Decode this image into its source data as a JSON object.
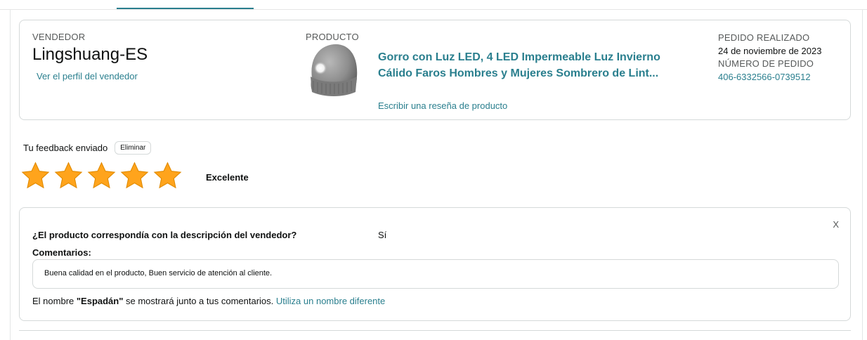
{
  "order": {
    "seller_label": "VENDEDOR",
    "seller_name": "Lingshuang-ES",
    "seller_profile_link": "Ver el perfil del vendedor",
    "product_label": "PRODUCTO",
    "product_title": "Gorro con Luz LED, 4 LED Impermeable Luz Invierno Cálido Faros Hombres y Mujeres Sombrero de Lint...",
    "review_link": "Escribir una reseña de producto",
    "order_placed_label": "PEDIDO REALIZADO",
    "order_date": "24 de noviembre de 2023",
    "order_number_label": "NÚMERO DE PEDIDO",
    "order_number": "406-6332566-0739512"
  },
  "feedback": {
    "sent_label": "Tu feedback enviado",
    "delete_button": "Eliminar",
    "rating": 5,
    "rating_max": 5,
    "rating_text": "Excelente",
    "star_color": "#ffa41c"
  },
  "comment": {
    "close": "X",
    "question": "¿El producto correspondía con la descripción del vendedor?",
    "answer": "Sí",
    "comments_label": "Comentarios:",
    "comments_text": "Buena calidad en el producto, Buen servicio de atención al cliente.",
    "name_prefix": "El nombre ",
    "display_name": "\"Espadán\"",
    "name_suffix": " se mostrará junto a tus comentarios.",
    "change_name_link": "Utiliza un nombre diferente"
  },
  "colors": {
    "link": "#2a7f8e",
    "border": "#d5d9d9"
  }
}
